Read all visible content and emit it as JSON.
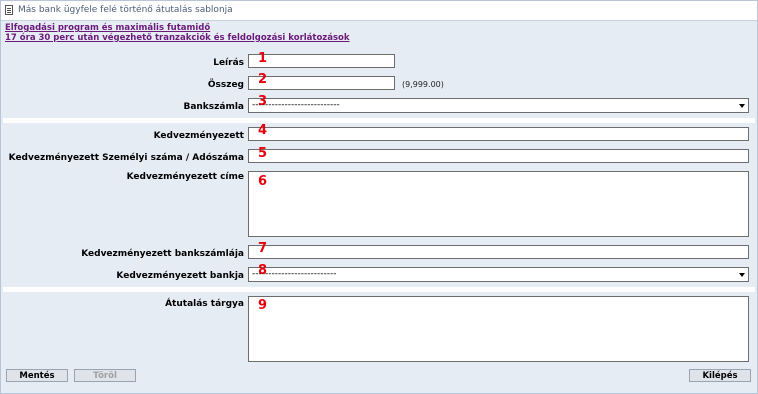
{
  "window": {
    "title": "Más bank ügyfele felé történő átutalás sablonja",
    "icon": "document-icon"
  },
  "links": [
    "Elfogadási program és maximális futamidő",
    "17 óra 30 perc után végezhető tranzakciók és feldolgozási korlátozások"
  ],
  "form": {
    "leiras": {
      "label": "Leírás",
      "value": "",
      "number": "1"
    },
    "osszeg": {
      "label": "Összeg",
      "value": "",
      "hint": "(9,999.00)",
      "number": "2"
    },
    "bankszamla": {
      "label": "Bankszámla",
      "selected": "---------------------------",
      "number": "3"
    },
    "kedvezmenyezett": {
      "label": "Kedvezményezett",
      "value": "",
      "number": "4"
    },
    "szemelyi_szam": {
      "label": "Kedvezményezett Személyi száma / Adószáma",
      "value": "",
      "number": "5"
    },
    "cime": {
      "label": "Kedvezményezett címe",
      "value": "",
      "number": "6"
    },
    "bankszamlaja": {
      "label": "Kedvezményezett bankszámlája",
      "value": "",
      "number": "7"
    },
    "bankja": {
      "label": "Kedvezményezett bankja",
      "selected": "--------------------------",
      "number": "8"
    },
    "targya": {
      "label": "Átutalás tárgya",
      "value": "",
      "number": "9"
    }
  },
  "buttons": {
    "save": "Mentés",
    "delete": "Töröl",
    "exit": "Kilépés"
  }
}
